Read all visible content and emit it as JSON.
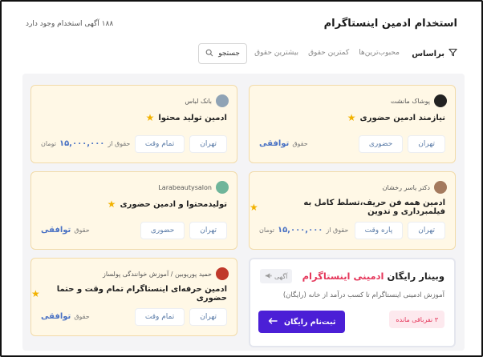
{
  "header": {
    "title": "استخدام ادمین اینستاگرام",
    "ads_count": "۱۸۸ آگهی استخدام وجود دارد"
  },
  "toolbar": {
    "filter_label": "براساس",
    "sort_options": [
      "محبوب‌ترین‌ها",
      "کمترین حقوق",
      "بیشترین حقوق"
    ],
    "search_label": "جستجو"
  },
  "cards": [
    {
      "company": "پوشاک مانشت",
      "title": "نیازمند ادمین حضوری",
      "tags": [
        "تهران",
        "حضوری"
      ],
      "salary_label": "حقوق",
      "salary_value": "توافقی",
      "salary_unit": "",
      "avatar_color": "#222222"
    },
    {
      "company": "بانک لباس",
      "title": "ادمین تولید محتوا",
      "tags": [
        "تهران",
        "تمام وقت"
      ],
      "salary_label": "حقوق از",
      "salary_value": "۱۵,۰۰۰,۰۰۰",
      "salary_unit": "تومان",
      "avatar_color": "#8fa3b5"
    },
    {
      "company": "دکتر یاسر رخشان",
      "title": "ادمین همه فن حریف،تسلط کامل به فیلمبرداری و تدوین",
      "tags": [
        "تهران",
        "پاره وقت"
      ],
      "salary_label": "حقوق از",
      "salary_value": "۱۵,۰۰۰,۰۰۰",
      "salary_unit": "تومان",
      "avatar_color": "#a47a5e"
    },
    {
      "company": "Larabeautysalon",
      "title": "تولیدمحتوا و ادمین حضوری",
      "tags": [
        "تهران",
        "حضوری"
      ],
      "salary_label": "حقوق",
      "salary_value": "توافقی",
      "salary_unit": "",
      "avatar_color": "#6fb59a"
    },
    {
      "company": "حمید پوریوبین / آموزش خوانندگی پولساز",
      "title": "ادمین حرفه‌ای اینستاگرام تمام وقت و حتما حضوری",
      "tags": [
        "تهران",
        "تمام وقت"
      ],
      "salary_label": "حقوق",
      "salary_value": "توافقی",
      "salary_unit": "",
      "avatar_color": "#c0392b"
    }
  ],
  "promo": {
    "title_prefix": "وبینار رایگان",
    "title_accent": "ادمینی اینستاگرام",
    "subtitle": "آموزش ادمینی اینستاگرام تا کسب درآمد از خانه (رایگان)",
    "badge": "آگهی",
    "remaining": "۳ نفرباقی مانده",
    "cta": "ثبت‌نام رایگان"
  },
  "colors": {
    "card_bg": "#fff8e6",
    "accent_blue": "#4a72c4",
    "cta_purple": "#4b1fd6",
    "accent_red": "#e5365a"
  }
}
